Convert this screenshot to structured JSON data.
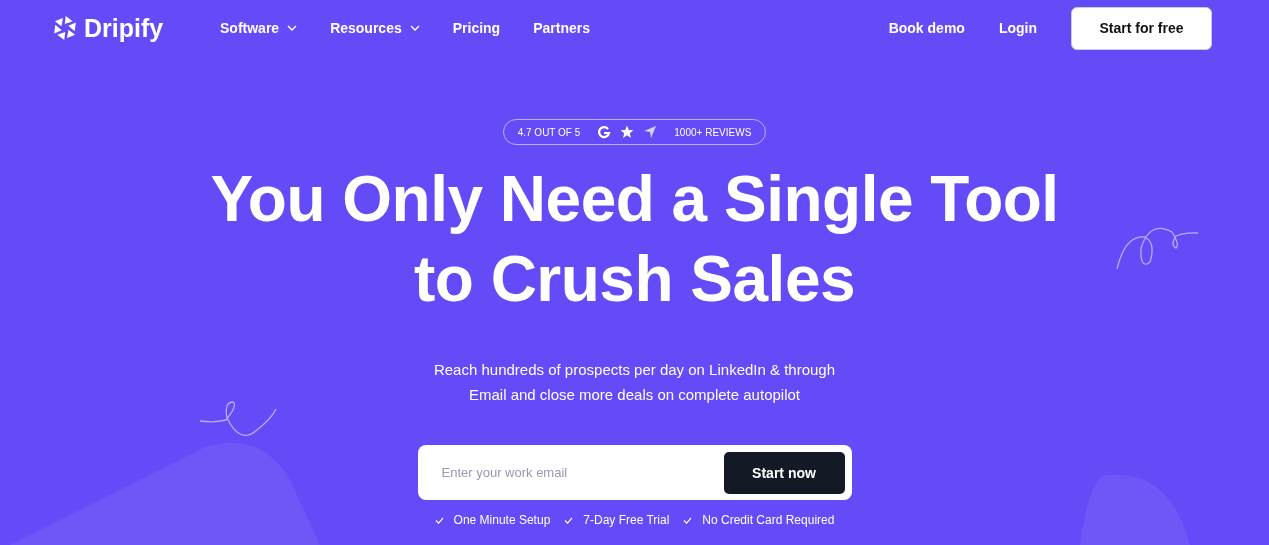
{
  "brand": {
    "name": "Dripify"
  },
  "nav": [
    {
      "label": "Software",
      "has_menu": true
    },
    {
      "label": "Resources",
      "has_menu": true
    },
    {
      "label": "Pricing",
      "has_menu": false
    },
    {
      "label": "Partners",
      "has_menu": false
    }
  ],
  "actions": [
    {
      "label": "Book demo",
      "kind": "link"
    },
    {
      "label": "Login",
      "kind": "link"
    },
    {
      "label": "Start for free",
      "kind": "button"
    }
  ],
  "rating": {
    "score": "4.7 OUT OF 5",
    "reviews": "1000+ REVIEWS"
  },
  "headline": [
    "You Only Need a Single Tool",
    "to Crush Sales"
  ],
  "subtitle": [
    "Reach hundreds of prospects per day on LinkedIn & through",
    "Email and close more deals on complete autopilot"
  ],
  "signup": {
    "placeholder": "Enter your work email",
    "button": "Start now"
  },
  "perks": [
    "One Minute Setup",
    "7-Day Free Trial",
    "No Credit Card Required"
  ]
}
